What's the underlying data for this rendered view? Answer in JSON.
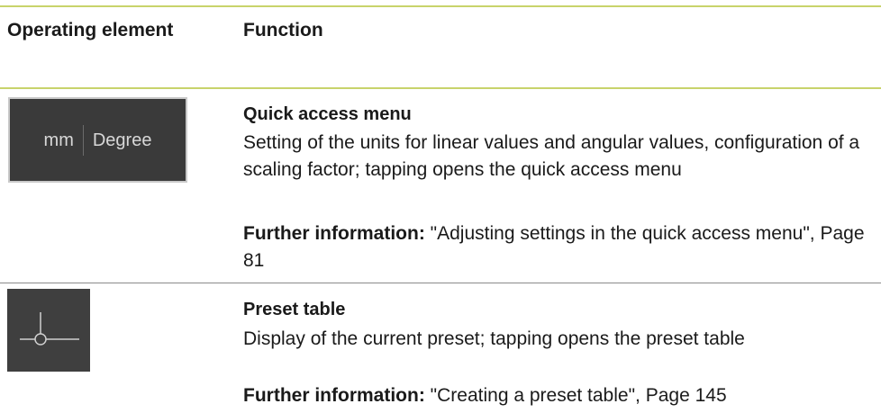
{
  "header": {
    "col1": "Operating element",
    "col2": "Function"
  },
  "rows": [
    {
      "icon": {
        "name": "units-display-icon",
        "unit_linear": "mm",
        "unit_angular": "Degree"
      },
      "title": "Quick access menu",
      "description": "Setting of the units for linear values and angular values, configuration of a scaling factor; tapping opens the quick access menu",
      "further_label": "Further information:",
      "further_text": " \"Adjusting settings in the quick access menu\", Page 81"
    },
    {
      "icon": {
        "name": "preset-crosshair-icon"
      },
      "title": "Preset table",
      "description": "Display of the current preset; tapping opens the preset table",
      "further_label": "Further information:",
      "further_text": " \"Creating a preset table\", Page 145"
    }
  ],
  "colors": {
    "rule_accent": "#c8d36b",
    "icon_background": "#3a3a3a"
  }
}
